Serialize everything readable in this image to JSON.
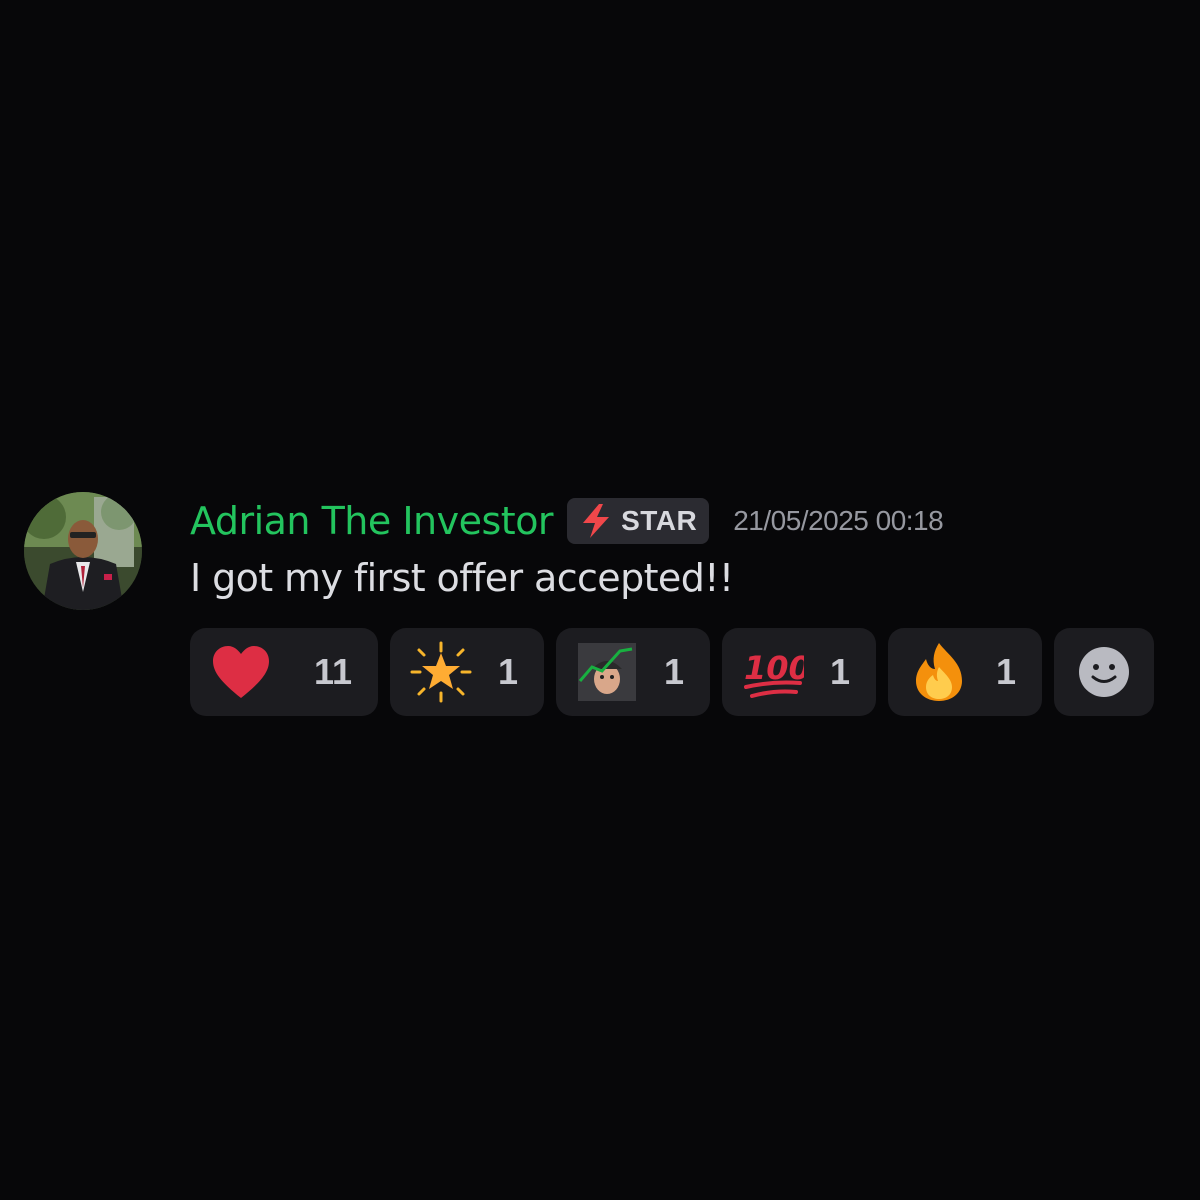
{
  "message": {
    "author": {
      "name": "Adrian The Investor",
      "name_color": "#23c45e",
      "avatar_icon": "user-avatar-photo"
    },
    "role_tag": {
      "icon": "lightning-bolt-icon",
      "label": "STAR"
    },
    "timestamp": "21/05/2025 00:18",
    "content": "I got my first offer accepted!!",
    "reactions": [
      {
        "icon": "red-heart-icon",
        "count": "11"
      },
      {
        "icon": "glowing-star-icon",
        "count": "1"
      },
      {
        "icon": "custom-face-chart-icon",
        "count": "1"
      },
      {
        "icon": "hundred-points-icon",
        "count": "1"
      },
      {
        "icon": "fire-icon",
        "count": "1"
      }
    ],
    "add_reaction_icon": "smiley-add-reaction-icon"
  }
}
